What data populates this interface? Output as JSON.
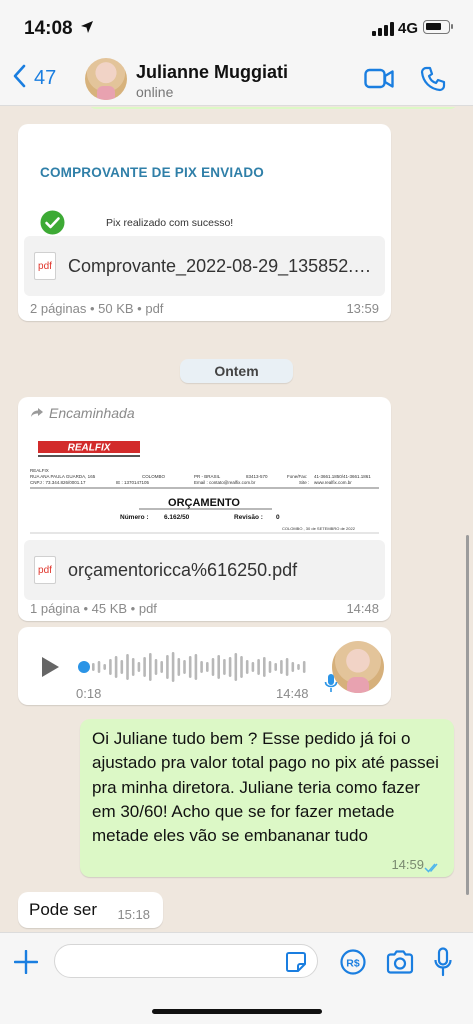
{
  "status_bar": {
    "time": "14:08",
    "network": "4G"
  },
  "header": {
    "back_count": "47",
    "contact_name": "Julianne Muggiati",
    "contact_status": "online"
  },
  "messages": {
    "pix": {
      "preview_title": "COMPROVANTE DE PIX ENVIADO",
      "preview_text": "Pix realizado com sucesso!",
      "file_type_icon": "pdf",
      "filename": "Comprovante_2022-08-29_135852.pdf",
      "details": "2 páginas • 50 KB • pdf",
      "time": "13:59"
    },
    "date_separator": "Ontem",
    "orcamento": {
      "forwarded_label": "Encaminhada",
      "preview_brand": "REALFIX",
      "preview_company": "REALFIX",
      "preview_address": "RUA ANA PAULA GUARDA, 165",
      "preview_city": "COLOMBO",
      "preview_state": "PR - BRASIL",
      "preview_cep": "83413-570",
      "preview_phone_label": "Fone/Fax:",
      "preview_phones": "41-3661.1850/41-3661.1861",
      "preview_cnpj": "CNPJ : 73.344.826/0001.17",
      "preview_ie": "IE : 1370147105",
      "preview_email": "Email : contato@realfix.com.br",
      "preview_site_label": "Site :",
      "preview_site": "www.realfix.com.br",
      "preview_heading": "ORÇAMENTO",
      "preview_numero_label": "Número :",
      "preview_numero": "6.162/50",
      "preview_revisao_label": "Revisão :",
      "preview_revisao": "0",
      "preview_date": "COLOMBO , 30 de SETEMBRO de 2022",
      "file_type_icon": "pdf",
      "filename": "orçamentoricca%616250.pdf",
      "details": "1 página • 45 KB • pdf",
      "time": "14:48"
    },
    "audio": {
      "duration": "0:18",
      "time": "14:48"
    },
    "outgoing": {
      "text": "Oi Juliane tudo bem ? Esse pedido já foi o ajustado pra valor total pago no pix até passei pra minha diretora.  Juliane teria como fazer em 30/60! Acho que se for fazer metade metade eles vão se embananar tudo",
      "time": "14:59"
    },
    "reply": {
      "text": "Pode ser",
      "time": "15:18"
    }
  },
  "icons": {
    "location": "location-arrow-icon",
    "back": "chevron-left-icon",
    "video": "video-call-icon",
    "phone": "phone-icon",
    "forward": "forward-arrow-icon",
    "play": "play-icon",
    "mic": "microphone-icon",
    "plus": "plus-icon",
    "sticker": "sticker-icon",
    "payment": "payment-icon",
    "camera": "camera-icon"
  },
  "colors": {
    "accent": "#1a7ee0",
    "outgoing_bubble": "#dcf8c6",
    "incoming_bubble": "#ffffff",
    "chat_background": "#efe7de",
    "read_ticks": "#4fb6ec",
    "check_green": "#3daa35",
    "brand_red": "#d22b2b"
  }
}
